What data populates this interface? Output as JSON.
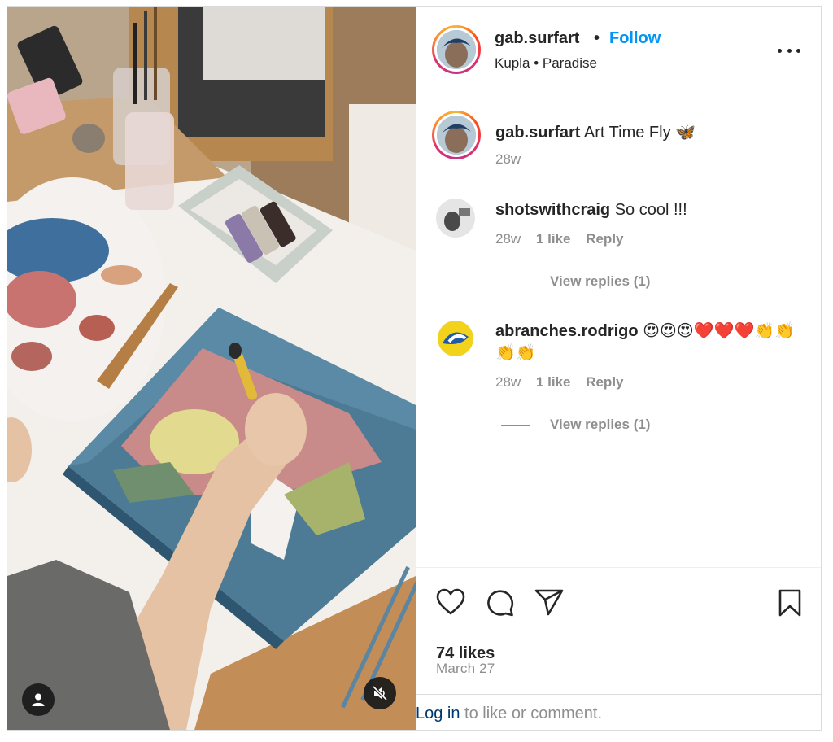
{
  "post": {
    "username": "gab.surfart",
    "follow_label": "Follow",
    "location": "Kupla • Paradise",
    "separator": "•"
  },
  "caption": {
    "username": "gab.surfart",
    "text": " Art Time Fly 🦋",
    "time": "28w"
  },
  "comments": [
    {
      "username": "shotswithcraig",
      "text": " So cool !!!",
      "time": "28w",
      "likes": "1 like",
      "reply": "Reply",
      "view_replies": "View replies (1)"
    },
    {
      "username": "abranches.rodrigo",
      "text": " 😍😍😍❤️❤️❤️👏👏👏👏",
      "time": "28w",
      "likes": "1 like",
      "reply": "Reply",
      "view_replies": "View replies (1)"
    }
  ],
  "footer": {
    "likes_count": "74 likes",
    "date": "March 27",
    "login_link": "Log in",
    "login_rest": " to like or comment."
  },
  "icons": {
    "like": "heart-icon",
    "comment": "comment-bubble-icon",
    "share": "paper-plane-icon",
    "save": "bookmark-icon",
    "more": "more-dots-icon",
    "user_tags": "user-icon",
    "mute": "speaker-muted-icon"
  },
  "colors": {
    "accent": "#0095f6",
    "text": "#262626",
    "muted": "#8e8e8e",
    "link": "#00376b"
  }
}
